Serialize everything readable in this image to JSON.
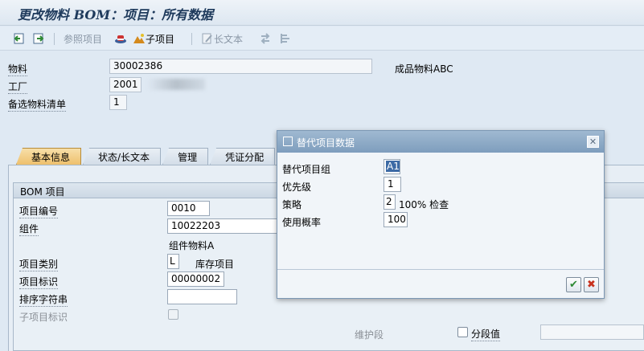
{
  "title": "更改物料 BOM：项目：所有数据",
  "toolbar": {
    "ref_item_label": "参照项目",
    "subitem_label": "子项目",
    "longtext_label": "长文本"
  },
  "header": {
    "material_label": "物料",
    "material_value": "30002386",
    "material_desc": "成品物料ABC",
    "plant_label": "工厂",
    "plant_value": "2001",
    "altbom_label": "备选物料清单",
    "altbom_value": "1"
  },
  "tabs": [
    "基本信息",
    "状态/长文本",
    "管理",
    "凭证分配"
  ],
  "group": {
    "title": "BOM 项目",
    "item_no_label": "项目编号",
    "item_no_value": "0010",
    "component_label": "组件",
    "component_value": "10022203",
    "component_desc": "组件物料A",
    "item_cat_label": "项目类别",
    "item_cat_value": "L",
    "item_cat_desc": "库存项目",
    "item_id_label": "项目标识",
    "item_id_value": "00000002",
    "sort_label": "排序字符串",
    "sort_value": "",
    "subitem_id_label": "子项目标识",
    "maint_label": "维护段",
    "segval_label": "分段值"
  },
  "dialog": {
    "title": "替代项目数据",
    "altgroup_label": "替代项目组",
    "altgroup_value": "A1",
    "priority_label": "优先级",
    "priority_value": "1",
    "strategy_label": "策略",
    "strategy_value": "2",
    "strategy_desc": "100% 检查",
    "usage_label": "使用概率",
    "usage_value": "100",
    "ok_icon": "✔",
    "cancel_icon": "✖"
  }
}
